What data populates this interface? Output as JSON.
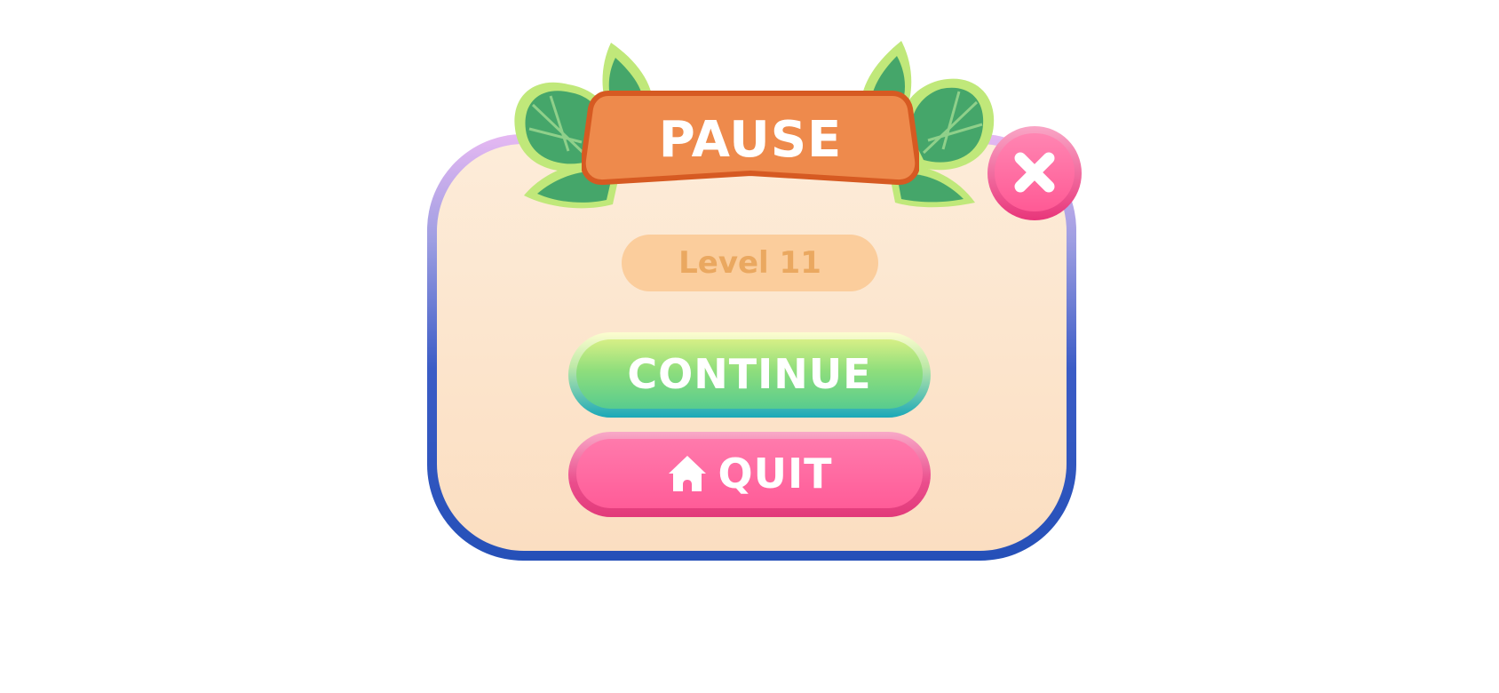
{
  "dialog": {
    "title": "PAUSE",
    "level_label": "Level 11",
    "continue_label": "CONTINUE",
    "quit_label": "QUIT"
  },
  "icons": {
    "close": "close-x-icon",
    "quit": "home-icon",
    "decoration": "leaf-icon"
  },
  "colors": {
    "banner": "#ee8a4c",
    "banner_outline": "#d65a22",
    "continue_button": "#8fde7c",
    "quit_button": "#ff5c98",
    "close_button": "#ff6aa0",
    "panel": "#fde6cf",
    "panel_border": "#2550b8",
    "leaf": "#45a66a"
  }
}
